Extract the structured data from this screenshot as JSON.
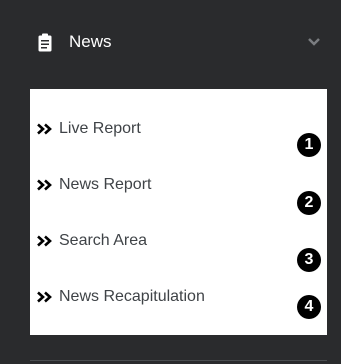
{
  "menu": {
    "title": "News",
    "icon": "clipboard-icon",
    "expand_icon": "chevron-down-icon",
    "items": [
      {
        "label": "Live Report",
        "icon": "double-chevron-right-icon"
      },
      {
        "label": "News Report",
        "icon": "double-chevron-right-icon"
      },
      {
        "label": "Search Area",
        "icon": "double-chevron-right-icon"
      },
      {
        "label": "News Recapitulation",
        "icon": "double-chevron-right-icon"
      }
    ]
  },
  "badges": [
    "1",
    "2",
    "3",
    "4"
  ],
  "colors": {
    "sidebar_background": "#2a2b2d",
    "submenu_background": "#ffffff",
    "header_text": "#ffffff",
    "item_text": "#3f4347",
    "badge_background": "#000000"
  }
}
